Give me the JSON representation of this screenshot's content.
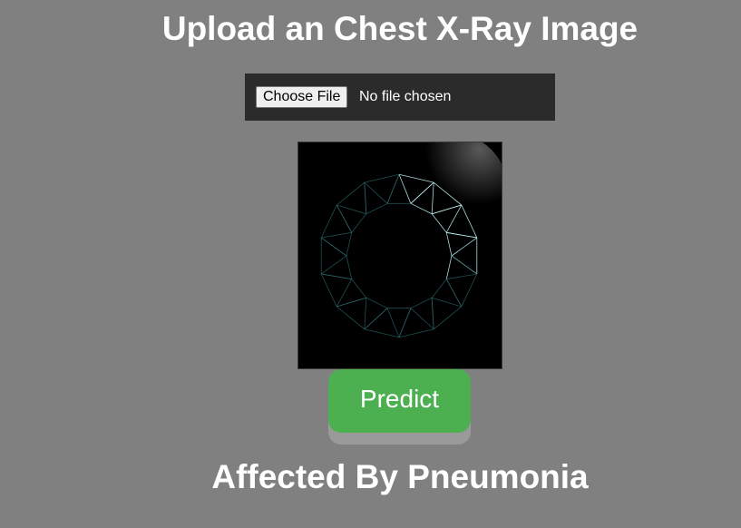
{
  "page": {
    "title": "Upload an Chest X-Ray Image",
    "background_color": "#808080"
  },
  "upload": {
    "choose_button_label": "Choose File",
    "status_text": "No file chosen",
    "box_color": "#2b2b2b"
  },
  "preview": {
    "description_icon": "wireframe-ring-image",
    "background_color": "#000000"
  },
  "actions": {
    "predict_label": "Predict",
    "predict_color": "#4caf50"
  },
  "result": {
    "text": "Affected By Pneumonia"
  }
}
